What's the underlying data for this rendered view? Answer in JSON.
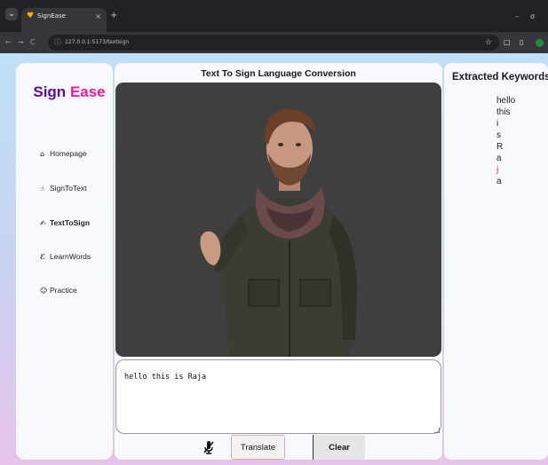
{
  "browser": {
    "tab_title": "SignEase",
    "tab_close": "×",
    "new_tab": "+",
    "minimize": "–",
    "close": "σ",
    "back": "←",
    "forward": "→",
    "reload": "C",
    "site_info": "ⓘ",
    "url": "127.0.0.1:5173/textsign",
    "bookmark": "☆",
    "extensions": "▢",
    "sidebar_toggle": "▯"
  },
  "sidebar": {
    "brand_sign": "Sign",
    "brand_ease": "Ease",
    "items": [
      {
        "label": "Homepage",
        "icon": "home-icon",
        "glyph": "🏠"
      },
      {
        "label": "SignToText",
        "icon": "hand-sign-icon",
        "glyph": "✋"
      },
      {
        "label": "TextToSign",
        "icon": "text-to-sign-icon",
        "glyph": "✍",
        "active": true
      },
      {
        "label": "LearnWords",
        "icon": "learn-words-icon",
        "glyph": "🔤"
      },
      {
        "label": "Practice",
        "icon": "practice-icon",
        "glyph": "☺"
      }
    ]
  },
  "main": {
    "title": "Text To Sign Language Conversion",
    "input_value": "hello this is Raja",
    "translate_label": "Translate",
    "clear_label": "Clear"
  },
  "keywords": {
    "title": "Extracted Keywords:",
    "items": [
      "hello",
      "this",
      "i",
      "s",
      "R",
      "a",
      "j",
      "a"
    ],
    "highlight_index": 6,
    "highlight_color": "#d22a2a"
  },
  "colors": {
    "brand_sign": "#5a0e99",
    "brand_ease": "#ee1aa5",
    "video_bg": "#3f3f3f"
  }
}
